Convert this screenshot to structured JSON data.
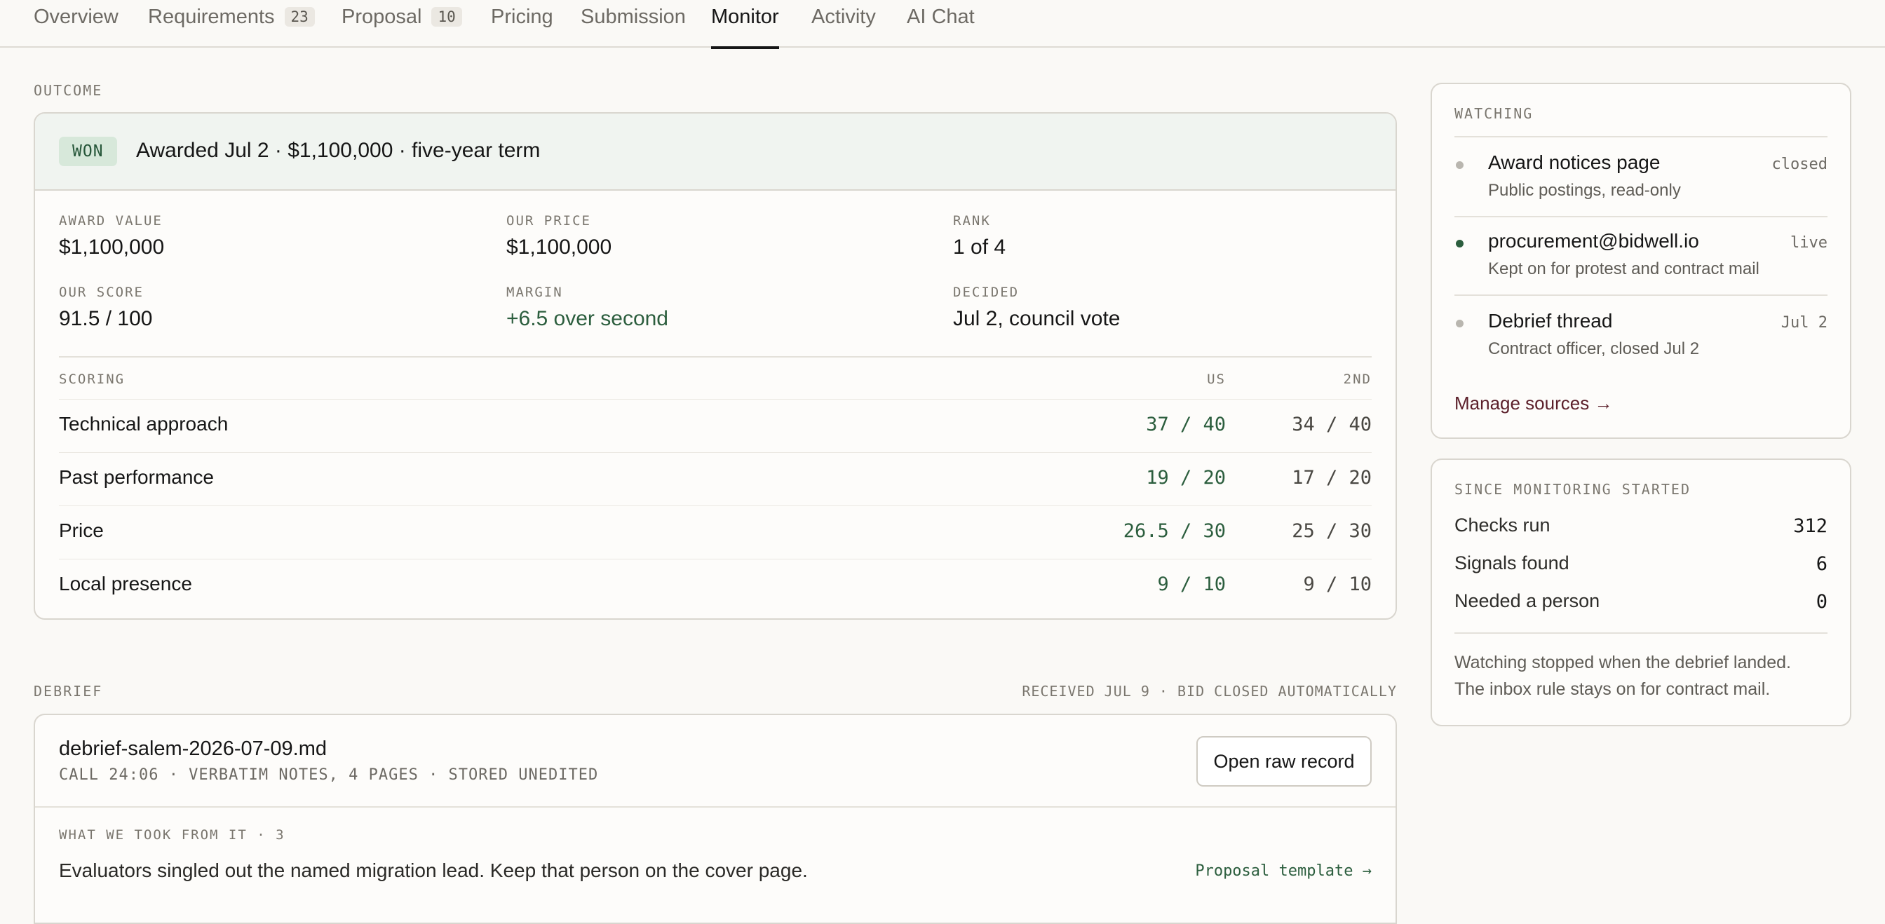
{
  "tabs": [
    {
      "label": "Overview"
    },
    {
      "label": "Requirements",
      "count": "23"
    },
    {
      "label": "Proposal",
      "count": "10"
    },
    {
      "label": "Pricing"
    },
    {
      "label": "Submission"
    },
    {
      "label": "Monitor",
      "active": true
    },
    {
      "label": "Activity"
    },
    {
      "label": "AI Chat"
    }
  ],
  "outcome": {
    "section_label": "OUTCOME",
    "badge": "WON",
    "title": "Awarded Jul 2 · $1,100,000 · five-year term",
    "stats": [
      {
        "label": "AWARD VALUE",
        "value": "$1,100,000"
      },
      {
        "label": "OUR PRICE",
        "value": "$1,100,000"
      },
      {
        "label": "RANK",
        "value": "1 of 4"
      },
      {
        "label": "OUR SCORE",
        "value": "91.5 / 100"
      },
      {
        "label": "MARGIN",
        "value": "+6.5 over second"
      },
      {
        "label": "DECIDED",
        "value": "Jul 2, council vote"
      }
    ],
    "scoring": {
      "label": "SCORING",
      "col_us": "US",
      "col_second": "2ND",
      "rows": [
        {
          "name": "Technical approach",
          "us": "37 / 40",
          "second": "34 / 40"
        },
        {
          "name": "Past performance",
          "us": "19 / 20",
          "second": "17 / 20"
        },
        {
          "name": "Price",
          "us": "26.5 / 30",
          "second": "25 / 30"
        },
        {
          "name": "Local presence",
          "us": "9 / 10",
          "second": "9 / 10"
        }
      ]
    },
    "accent_color": "#2c5e3e"
  },
  "debrief": {
    "section_label": "DEBRIEF",
    "status": "RECEIVED JUL 9 · BID CLOSED AUTOMATICALLY",
    "file_name": "debrief-salem-2026-07-09.md",
    "file_meta": "CALL 24:06 · VERBATIM NOTES, 4 PAGES · STORED UNEDITED",
    "open_button": "Open raw record",
    "takeaways_label": "WHAT WE TOOK FROM IT · 3",
    "takeaways": [
      {
        "text": "Evaluators singled out the named migration lead. Keep that person on the cover page.",
        "link": "Proposal template →"
      }
    ]
  },
  "watching": {
    "label": "WATCHING",
    "items": [
      {
        "title": "Award notices page",
        "sub": "Public postings, read-only",
        "status": "closed",
        "live": false
      },
      {
        "title": "procurement@bidwell.io",
        "sub": "Kept on for protest and contract mail",
        "status": "live",
        "live": true
      },
      {
        "title": "Debrief thread",
        "sub": "Contract officer, closed Jul 2",
        "status": "Jul 2",
        "live": false
      }
    ],
    "manage_link": "Manage sources →"
  },
  "monitoring": {
    "label": "SINCE MONITORING STARTED",
    "metrics": [
      {
        "label": "Checks run",
        "value": "312"
      },
      {
        "label": "Signals found",
        "value": "6"
      },
      {
        "label": "Needed a person",
        "value": "0"
      }
    ],
    "note_line1": "Watching stopped when the debrief landed.",
    "note_line2": "The inbox rule stays on for contract mail."
  }
}
